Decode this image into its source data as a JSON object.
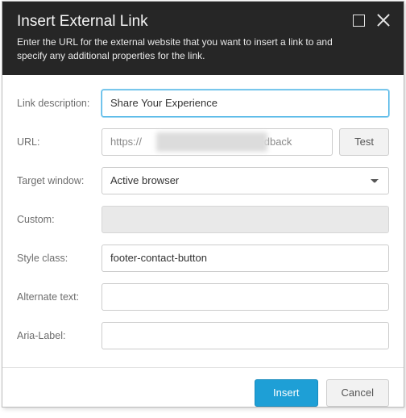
{
  "dialog": {
    "title": "Insert External Link",
    "description": "Enter the URL for the external website that you want to insert a link to and specify any additional properties for the link."
  },
  "form": {
    "link_desc_label": "Link description:",
    "link_desc_value": "Share Your Experience",
    "url_label": "URL:",
    "url_prefix": "https://",
    "url_suffix": "/feedback",
    "test_label": "Test",
    "target_label": "Target window:",
    "target_value": "Active browser",
    "custom_label": "Custom:",
    "style_label": "Style class:",
    "style_value": "footer-contact-button",
    "alt_label": "Alternate text:",
    "alt_value": "",
    "aria_label": "Aria-Label:",
    "aria_value": ""
  },
  "footer": {
    "insert": "Insert",
    "cancel": "Cancel"
  }
}
